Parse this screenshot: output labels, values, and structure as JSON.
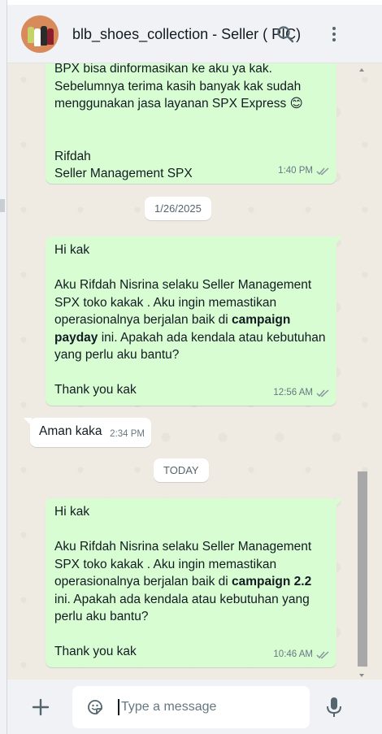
{
  "header": {
    "contact_name": "blb_shoes_collection - Seller ( PIC)",
    "avatar_icon": "store-avatar",
    "search_icon": "search-icon",
    "menu_icon": "more-vertical-icon"
  },
  "messages": [
    {
      "direction": "outgoing",
      "partial_top_line": "BPX bisa dinformasikan ke aku ya kak.",
      "text_lines": [
        "Sebelumnya terima kasih banyak kak sudah",
        "menggunakan jasa layanan SPX Express"
      ],
      "emoji": "😊",
      "signature_lines": [
        "Rifdah",
        "Seller Management SPX"
      ],
      "time": "1:40 PM",
      "status": "read"
    },
    {
      "type": "date_chip",
      "label": "1/26/2025"
    },
    {
      "direction": "outgoing",
      "greeting": "Hi kak",
      "body_before_bold": "Aku Rifdah Nisrina selaku Seller Management SPX toko kakak . Aku ingin memastikan operasionalnya berjalan baik di ",
      "bold": "campaign payday",
      "body_after_bold": " ini. Apakah ada kendala atau kebutuhan yang perlu aku bantu?",
      "closing": "Thank you kak",
      "time": "12:56 AM",
      "status": "read"
    },
    {
      "direction": "incoming",
      "text": "Aman kaka",
      "time": "2:34 PM"
    },
    {
      "type": "date_chip",
      "label": "TODAY"
    },
    {
      "direction": "outgoing",
      "greeting": "Hi kak",
      "body_before_bold": "Aku Rifdah Nisrina selaku Seller Management SPX toko kakak . Aku ingin memastikan operasionalnya berjalan baik di ",
      "bold": "campaign 2.2",
      "body_after_bold": " ini. Apakah ada kendala atau kebutuhan yang perlu aku bantu?",
      "closing": "Thank you kak",
      "time": "10:46 AM",
      "status": "read"
    }
  ],
  "composer": {
    "placeholder": "Type a message",
    "value": "",
    "attach_icon": "plus-icon",
    "sticker_icon": "sticker-icon",
    "mic_icon": "microphone-icon"
  },
  "colors": {
    "outgoing_bubble": "#d9fdd3",
    "incoming_bubble": "#ffffff",
    "chat_background": "#efeae2",
    "header_background": "#f0f2f5",
    "read_tick": "#8696a0"
  }
}
